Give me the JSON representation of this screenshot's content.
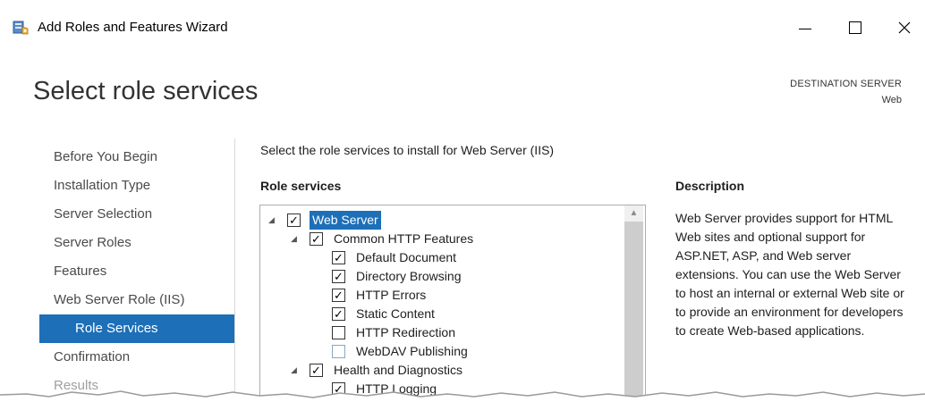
{
  "window": {
    "title": "Add Roles and Features Wizard",
    "minimize_glyph": "",
    "close_glyph": "✕"
  },
  "header": {
    "page_title": "Select role services",
    "destination_label": "DESTINATION SERVER",
    "destination_value": "Web"
  },
  "nav": {
    "items": [
      {
        "label": "Before You Begin",
        "state": "normal"
      },
      {
        "label": "Installation Type",
        "state": "normal"
      },
      {
        "label": "Server Selection",
        "state": "normal"
      },
      {
        "label": "Server Roles",
        "state": "normal"
      },
      {
        "label": "Features",
        "state": "normal"
      },
      {
        "label": "Web Server Role (IIS)",
        "state": "normal"
      },
      {
        "label": "Role Services",
        "state": "active"
      },
      {
        "label": "Confirmation",
        "state": "normal"
      },
      {
        "label": "Results",
        "state": "disabled"
      }
    ]
  },
  "main": {
    "intro": "Select the role services to install for Web Server (IIS)",
    "role_services_heading": "Role services",
    "description_heading": "Description",
    "description_text": "Web Server provides support for HTML Web sites and optional support for ASP.NET, ASP, and Web server extensions. You can use the Web Server to host an internal or external Web site or to provide an environment for developers to create Web-based applications."
  },
  "tree": {
    "items": [
      {
        "label": "Web Server",
        "level": 0,
        "checked": true,
        "expandable": true,
        "selected": true
      },
      {
        "label": "Common HTTP Features",
        "level": 1,
        "checked": true,
        "expandable": true,
        "selected": false
      },
      {
        "label": "Default Document",
        "level": 2,
        "checked": true,
        "expandable": false,
        "selected": false
      },
      {
        "label": "Directory Browsing",
        "level": 2,
        "checked": true,
        "expandable": false,
        "selected": false
      },
      {
        "label": "HTTP Errors",
        "level": 2,
        "checked": true,
        "expandable": false,
        "selected": false
      },
      {
        "label": "Static Content",
        "level": 2,
        "checked": true,
        "expandable": false,
        "selected": false
      },
      {
        "label": "HTTP Redirection",
        "level": 2,
        "checked": false,
        "expandable": false,
        "selected": false
      },
      {
        "label": "WebDAV Publishing",
        "level": 2,
        "checked": false,
        "expandable": false,
        "selected": false
      },
      {
        "label": "Health and Diagnostics",
        "level": 1,
        "checked": true,
        "expandable": true,
        "selected": false
      },
      {
        "label": "HTTP Logging",
        "level": 2,
        "checked": true,
        "expandable": false,
        "selected": false
      }
    ]
  },
  "colors": {
    "accent": "#1d6fb8",
    "nav_text": "#4a4a4a",
    "nav_disabled": "#a0a0a0"
  }
}
